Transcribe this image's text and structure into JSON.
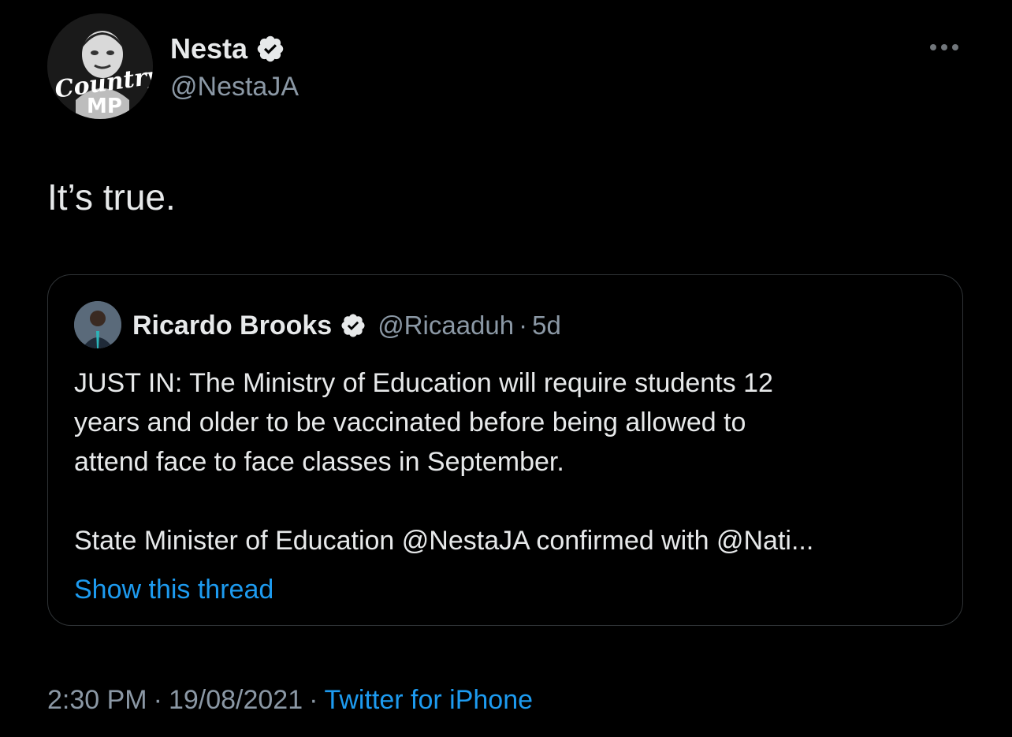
{
  "colors": {
    "background": "#000000",
    "text_primary": "#e7e9ea",
    "text_secondary": "#8b98a5",
    "link": "#1d9bf0",
    "verified_badge": "#e7e9ea",
    "border": "#2f3336"
  },
  "author": {
    "name": "Nesta",
    "handle": "@NestaJA",
    "verified": true,
    "avatar_logo": "Country MP",
    "avatar_icon": "profile-photo"
  },
  "tweet": {
    "text": "It’s true."
  },
  "more_icon": "more-horizontal-icon",
  "quoted_tweet": {
    "author_name": "Ricardo Brooks",
    "author_handle": "@Ricaaduh",
    "separator": "·",
    "relative_time": "5d",
    "verified": true,
    "text_lines": [
      "JUST IN: The Ministry of Education will require students 12",
      "years and older to be vaccinated before being allowed to",
      "attend face to face classes in September.",
      "State Minister of Education @NestaJA confirmed with @Nati..."
    ],
    "show_thread_label": "Show this thread"
  },
  "footer": {
    "time": "2:30 PM",
    "separator": "·",
    "date": "19/08/2021",
    "source": "Twitter for iPhone"
  }
}
